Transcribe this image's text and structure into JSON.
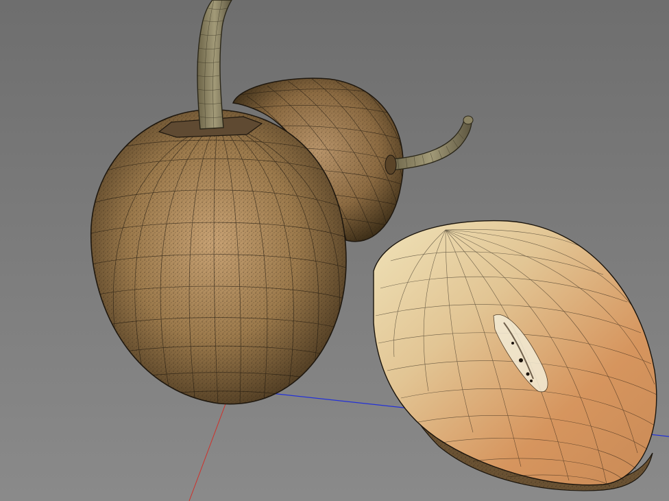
{
  "viewport": {
    "background_top": "#707070",
    "background_bottom": "#8a8a8a"
  },
  "axes": {
    "x_axis_color": "#2230d8",
    "y_axis_color": "#d0302a"
  },
  "objects": [
    {
      "name": "kiwi-fruit-front-model",
      "skin_color": "#9a7a4e",
      "wire_color": "#1c160e"
    },
    {
      "name": "kiwi-fruit-back-model",
      "skin_color": "#9c7b4d",
      "wire_color": "#1c160e"
    },
    {
      "name": "kiwi-half-cut-model",
      "flesh_color": "#d9a66e",
      "wire_color": "#1a140c"
    }
  ]
}
